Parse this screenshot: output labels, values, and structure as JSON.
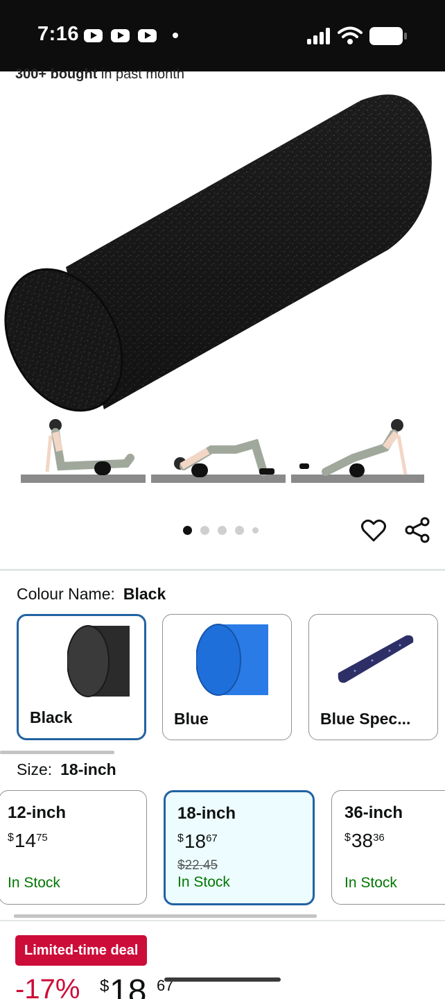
{
  "status_bar": {
    "time": "7:16",
    "icons": [
      "youtube-icon",
      "youtube-icon",
      "youtube-icon",
      "notification-dot",
      "signal-icon",
      "wifi-icon",
      "battery-icon"
    ]
  },
  "bought": {
    "count": "300+ bought",
    "suffix": " in past month"
  },
  "gallery": {
    "total_images": 5,
    "active_index": 0,
    "icons": [
      "heart-icon",
      "share-icon"
    ]
  },
  "colour": {
    "label": "Colour Name:",
    "selected": "Black",
    "options": [
      {
        "label": "Black",
        "swatch_color": "#2b2b2b"
      },
      {
        "label": "Blue",
        "swatch_color": "#1e6fd9"
      },
      {
        "label": "Blue Spec...",
        "swatch_color": "#2d2f66"
      }
    ]
  },
  "size": {
    "label": "Size:",
    "selected": "18-inch",
    "options": [
      {
        "name": "12-inch",
        "currency": "$",
        "whole": "14",
        "fraction": "75",
        "old_price": "",
        "stock": "In Stock"
      },
      {
        "name": "18-inch",
        "currency": "$",
        "whole": "18",
        "fraction": "67",
        "old_price": "$22.45",
        "stock": "In Stock"
      },
      {
        "name": "36-inch",
        "currency": "$",
        "whole": "38",
        "fraction": "36",
        "old_price": "",
        "stock": "In Stock"
      }
    ]
  },
  "deal": {
    "badge": "Limited-time deal",
    "discount": "-17%",
    "currency": "$",
    "whole": "18",
    "fraction": "67"
  },
  "colors": {
    "accent_blue": "#2162a1",
    "deal_red": "#cc0c39",
    "stock_green": "#007600",
    "selected_bg": "#edfdff"
  }
}
